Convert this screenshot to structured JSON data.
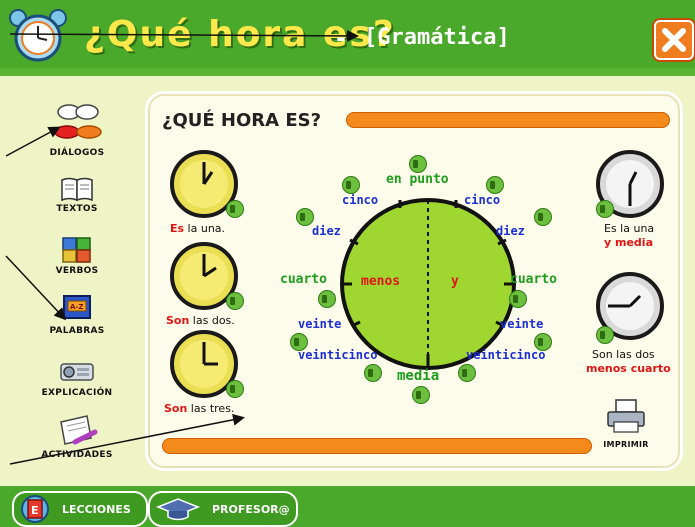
{
  "header": {
    "title": "¿Qué hora es?",
    "separator": "-",
    "subtitle": "[Gramática]",
    "close_icon": "close-icon"
  },
  "sidebar": {
    "items": [
      {
        "label": "DIÁLOGOS",
        "icon": "lips-speech-icon"
      },
      {
        "label": "TEXTOS",
        "icon": "book-icon"
      },
      {
        "label": "VERBOS",
        "icon": "blocks-icon"
      },
      {
        "label": "PALABRAS",
        "icon": "word-card-icon"
      },
      {
        "label": "EXPLICACIÓN",
        "icon": "projector-icon"
      },
      {
        "label": "ACTIVIDADES",
        "icon": "notebook-pen-icon"
      }
    ]
  },
  "panel": {
    "heading": "¿QUÉ HORA ES?",
    "print_label": "IMPRIMIR"
  },
  "dial": {
    "en_punto": "en punto",
    "cinco_left": "cinco",
    "cinco_right": "cinco",
    "diez_left": "diez",
    "diez_right": "diez",
    "cuarto_left": "cuarto",
    "cuarto_right": "cuarto",
    "menos": "menos",
    "y": "y",
    "veinte_left": "veinte",
    "veinte_right": "veinte",
    "veinticinco_left": "veinticinco",
    "veinticinco_right": "veinticinco",
    "media": "media"
  },
  "left_examples": [
    {
      "verb": "Es",
      "rest": " la una."
    },
    {
      "verb": "Son",
      "rest": " las dos."
    },
    {
      "verb": "Son",
      "rest": " las tres."
    }
  ],
  "right_examples": [
    {
      "line1": "Es la una",
      "line2": "y media"
    },
    {
      "line1": "Son las dos",
      "line2": "menos cuarto"
    }
  ],
  "bottom_nav": {
    "lessons": "LECCIONES",
    "teacher": "PROFESOR@"
  },
  "colors": {
    "header_green": "#4aa82a",
    "accent_orange": "#f48a1b",
    "dial_green": "#9fd630",
    "red_text": "#e01515",
    "blue_text": "#1a2fd6",
    "green_text": "#1c9e1c"
  }
}
